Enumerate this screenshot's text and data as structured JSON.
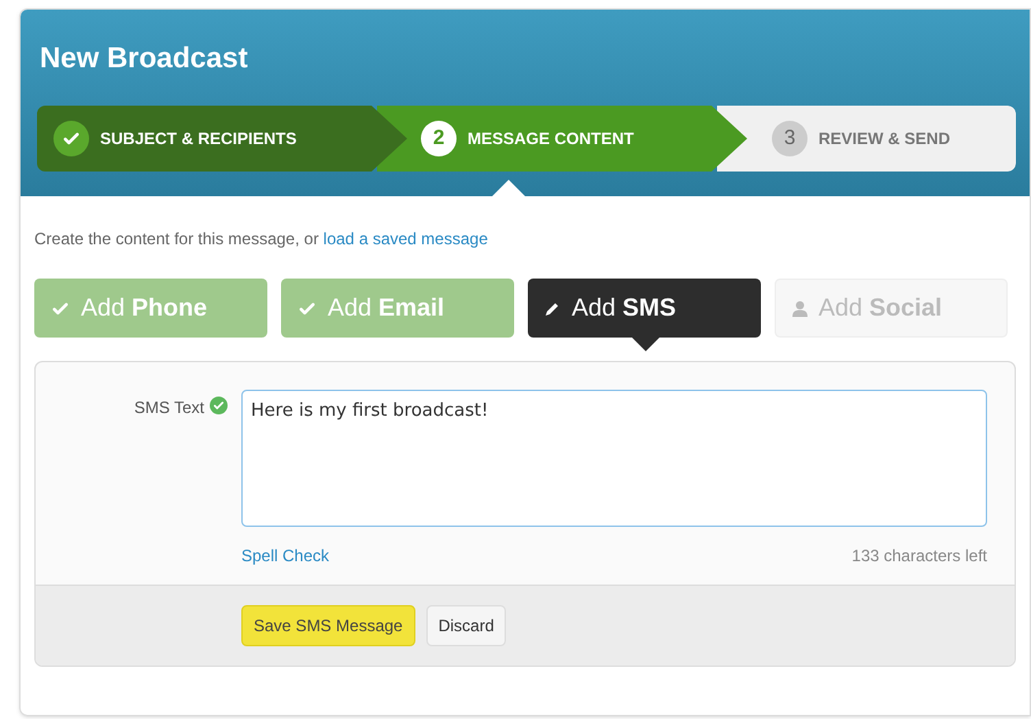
{
  "title": "New Broadcast",
  "steps": [
    {
      "label": "SUBJECT & RECIPIENTS",
      "completed": true,
      "selected": false
    },
    {
      "number": "2",
      "label": "MESSAGE CONTENT",
      "completed": false,
      "selected": true
    },
    {
      "number": "3",
      "label": "REVIEW & SEND",
      "completed": false,
      "selected": false
    }
  ],
  "intro": {
    "text": "Create the content for this message, or",
    "link": "load a saved message"
  },
  "tabs": [
    {
      "label": "Add **Phone**",
      "completed": true,
      "disabled": false,
      "selected": false
    },
    {
      "label": "Add **Email**",
      "completed": true,
      "disabled": false,
      "selected": false
    },
    {
      "label": "Add **SMS**",
      "completed": false,
      "disabled": false,
      "selected": true
    },
    {
      "label": "Add **Social**",
      "completed": false,
      "disabled": true,
      "selected": false
    }
  ],
  "form": {
    "label": "SMS Text",
    "valid": true,
    "value": "Here is my first broadcast!",
    "spell_check": "Spell Check",
    "counter": "133 characters left"
  },
  "buttons": [
    {
      "label": "Save SMS Message",
      "kind": "primary"
    },
    {
      "label": "Discard",
      "kind": "secondary"
    }
  ]
}
